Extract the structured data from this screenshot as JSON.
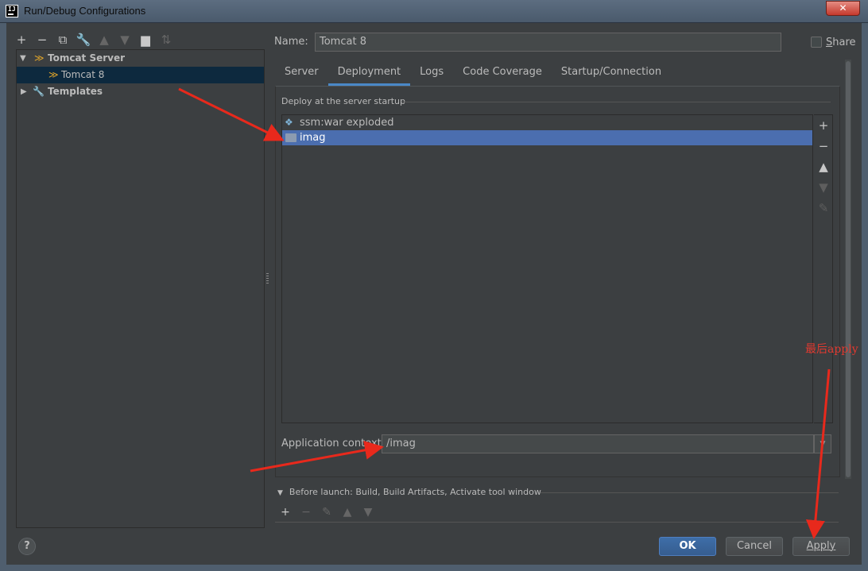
{
  "window": {
    "title": "Run/Debug Configurations",
    "app_icon_text": "IJ",
    "close_glyph": "✕"
  },
  "left_toolbar": [
    {
      "icon": "plus-icon",
      "glyph": "+",
      "enabled": true
    },
    {
      "icon": "minus-icon",
      "glyph": "−",
      "enabled": true
    },
    {
      "icon": "copy-icon",
      "glyph": "⧉",
      "enabled": true
    },
    {
      "icon": "wrench-icon",
      "glyph": "🔧",
      "enabled": true
    },
    {
      "icon": "move-up-icon",
      "glyph": "▲",
      "enabled": false
    },
    {
      "icon": "move-down-icon",
      "glyph": "▼",
      "enabled": false
    },
    {
      "icon": "folder-add-icon",
      "glyph": "▆",
      "enabled": true
    },
    {
      "icon": "sort-icon",
      "glyph": "⇅",
      "enabled": false
    }
  ],
  "tree": {
    "group_label": "Tomcat Server",
    "child_label": "Tomcat 8",
    "templates_label": "Templates"
  },
  "config": {
    "name_label": "Name:",
    "name_value": "Tomcat 8",
    "share_label": "Share"
  },
  "tabs": [
    "Server",
    "Deployment",
    "Logs",
    "Code Coverage",
    "Startup/Connection"
  ],
  "active_tab": "Deployment",
  "deployment": {
    "section_title": "Deploy at the server startup",
    "items": [
      {
        "label": "ssm:war exploded",
        "icon": "artifact-icon",
        "selected": false
      },
      {
        "label": "imag",
        "icon": "folder-icon",
        "selected": true
      }
    ],
    "side_tools": [
      {
        "icon": "plus-icon",
        "glyph": "+",
        "enabled": true
      },
      {
        "icon": "minus-icon",
        "glyph": "−",
        "enabled": true
      },
      {
        "icon": "move-up-icon",
        "glyph": "▲",
        "enabled": true
      },
      {
        "icon": "move-down-icon",
        "glyph": "▼",
        "enabled": false
      },
      {
        "icon": "edit-icon",
        "glyph": "✎",
        "enabled": false
      }
    ],
    "context_label": "Application context:",
    "context_value": "/imag"
  },
  "before_launch": {
    "label": "Before launch: Build, Build Artifacts, Activate tool window",
    "tools": [
      {
        "icon": "plus-icon",
        "glyph": "+",
        "enabled": true
      },
      {
        "icon": "minus-icon",
        "glyph": "−",
        "enabled": false
      },
      {
        "icon": "edit-icon",
        "glyph": "✎",
        "enabled": false
      },
      {
        "icon": "move-up-icon",
        "glyph": "▲",
        "enabled": false
      },
      {
        "icon": "move-down-icon",
        "glyph": "▼",
        "enabled": false
      }
    ]
  },
  "footer": {
    "help": "?",
    "ok": "OK",
    "cancel": "Cancel",
    "apply": "Apply"
  },
  "annotation": {
    "text": "最后apply",
    "color": "#e03a30"
  },
  "colors": {
    "background": "#3c3f41",
    "selection": "#4b6eaf",
    "tree_selection": "#0d293e",
    "accent": "#4a88c7"
  }
}
